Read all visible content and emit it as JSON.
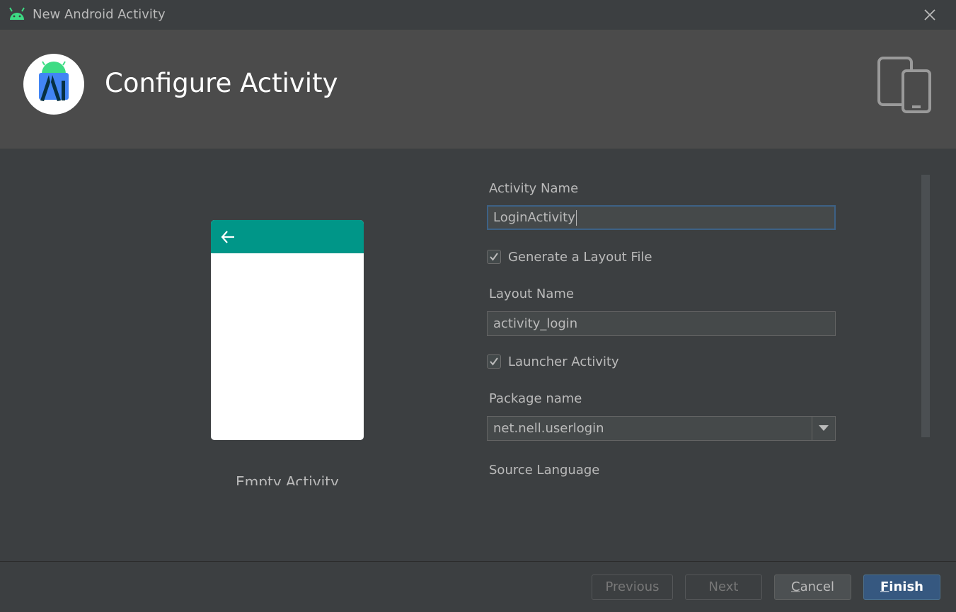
{
  "window": {
    "title": "New Android Activity"
  },
  "header": {
    "title": "Configure Activity"
  },
  "preview": {
    "caption": "Empty Activity"
  },
  "form": {
    "activity_name_label": "Activity Name",
    "activity_name_value": "LoginActivity",
    "generate_layout_label": "Generate a Layout File",
    "generate_layout_checked": true,
    "layout_name_label": "Layout Name",
    "layout_name_value": "activity_login",
    "launcher_activity_label": "Launcher Activity",
    "launcher_activity_checked": true,
    "package_name_label": "Package name",
    "package_name_value": "net.nell.userlogin",
    "source_language_label": "Source Language"
  },
  "footer": {
    "previous_label": "Previous",
    "next_label": "Next",
    "cancel_first": "C",
    "cancel_rest": "ancel",
    "finish_first": "F",
    "finish_rest": "inish"
  },
  "colors": {
    "accent": "#009688",
    "primary_button": "#365880",
    "android_green": "#3ddc84"
  },
  "icons": [
    "android-icon",
    "close-icon",
    "android-studio-logo",
    "devices-icon",
    "back-arrow-icon",
    "checkmark-icon",
    "chevron-down-icon"
  ]
}
